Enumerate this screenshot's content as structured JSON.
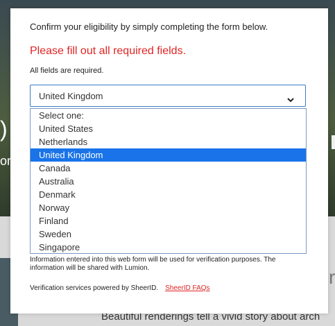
{
  "background": {
    "bottom_text": "Beautiful renderings tell a vivid story about arch",
    "right_text": "ro",
    "left_glyph_top": ")",
    "left_glyph_mid": "or"
  },
  "modal": {
    "intro": "Confirm your eligibility by simply completing the form below.",
    "error": "Please fill out all required fields.",
    "required_note": "All fields are required.",
    "country_select": {
      "value": "United Kingdom",
      "options": [
        "Select one:",
        "United States",
        "Netherlands",
        "United Kingdom",
        "Canada",
        "Australia",
        "Denmark",
        "Norway",
        "Finland",
        "Sweden",
        "Singapore"
      ],
      "selected_index": 3
    },
    "info_text": "Information entered into this web form will be used for verification purposes. The information will be shared with Lumion.",
    "footer_text": "Verification services powered by SheerID.",
    "faq_link": "SheerID FAQs"
  },
  "colors": {
    "error": "#e02424",
    "selected_bg": "#1a73e8",
    "focus_border": "#3b7bc7"
  }
}
